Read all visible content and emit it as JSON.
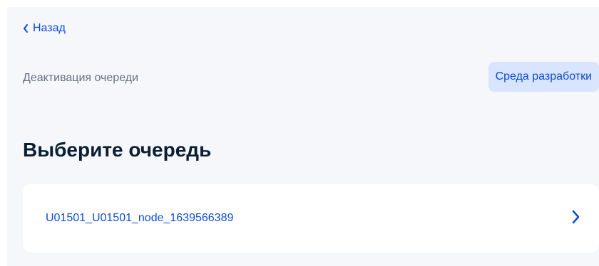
{
  "nav": {
    "back_label": "Назад",
    "back_icon": "chevron-left-icon"
  },
  "header": {
    "subtitle": "Деактивация очереди",
    "environment_badge": "Среда разработки"
  },
  "main": {
    "title": "Выберите очередь",
    "queues": [
      {
        "name": "U01501_U01501_node_1639566389",
        "icon": "chevron-right-icon"
      }
    ]
  },
  "colors": {
    "accent": "#0d4cd3",
    "background": "#f5f7fb",
    "badge_background": "#d9e4ff",
    "card_background": "#ffffff",
    "title_text": "#0b1f33",
    "secondary_text": "#66727f"
  }
}
